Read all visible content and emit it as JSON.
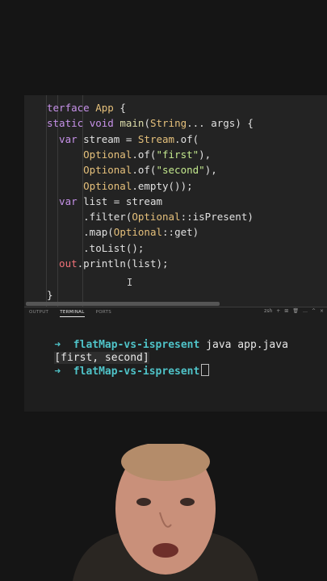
{
  "editor": {
    "lines": [
      {
        "parts": [
          {
            "t": "terface ",
            "c": "kw"
          },
          {
            "t": "App",
            "c": "cls"
          },
          {
            "t": " {",
            "c": "plain"
          }
        ]
      },
      {
        "parts": [
          {
            "t": "static ",
            "c": "kw"
          },
          {
            "t": "void ",
            "c": "kw"
          },
          {
            "t": "main",
            "c": "fn"
          },
          {
            "t": "(",
            "c": "plain"
          },
          {
            "t": "String",
            "c": "cls"
          },
          {
            "t": "... args) {",
            "c": "plain"
          }
        ]
      },
      {
        "parts": [
          {
            "t": "  var ",
            "c": "kw"
          },
          {
            "t": "stream",
            "c": "plain"
          },
          {
            "t": " = ",
            "c": "plain"
          },
          {
            "t": "Stream",
            "c": "cls"
          },
          {
            "t": ".of(",
            "c": "plain"
          }
        ]
      },
      {
        "parts": [
          {
            "t": "      Optional",
            "c": "cls"
          },
          {
            "t": ".of(",
            "c": "plain"
          },
          {
            "t": "\"first\"",
            "c": "str"
          },
          {
            "t": "),",
            "c": "plain"
          }
        ]
      },
      {
        "parts": [
          {
            "t": "      Optional",
            "c": "cls"
          },
          {
            "t": ".of(",
            "c": "plain"
          },
          {
            "t": "\"second\"",
            "c": "str"
          },
          {
            "t": "),",
            "c": "plain"
          }
        ]
      },
      {
        "parts": [
          {
            "t": "      Optional",
            "c": "cls"
          },
          {
            "t": ".empty());",
            "c": "plain"
          }
        ]
      },
      {
        "parts": [
          {
            "t": "  var ",
            "c": "kw"
          },
          {
            "t": "list = stream",
            "c": "plain"
          }
        ]
      },
      {
        "parts": [
          {
            "t": "      .filter(",
            "c": "plain"
          },
          {
            "t": "Optional",
            "c": "cls"
          },
          {
            "t": "::isPresent)",
            "c": "plain"
          }
        ]
      },
      {
        "parts": [
          {
            "t": "      .map(",
            "c": "plain"
          },
          {
            "t": "Optional",
            "c": "cls"
          },
          {
            "t": "::get)",
            "c": "plain"
          }
        ]
      },
      {
        "parts": [
          {
            "t": "      .toList();",
            "c": "plain"
          }
        ]
      },
      {
        "parts": [
          {
            "t": "  out",
            "c": "var"
          },
          {
            "t": ".println(list);",
            "c": "plain"
          }
        ]
      },
      {
        "parts": [
          {
            "t": "",
            "c": "plain"
          }
        ]
      },
      {
        "parts": [
          {
            "t": "}",
            "c": "plain"
          }
        ]
      }
    ]
  },
  "panel": {
    "tabs": [
      "OUTPUT",
      "TERMINAL",
      "PORTS"
    ],
    "active_tab": "TERMINAL",
    "tools": [
      "zsh",
      "+",
      "⊞",
      "🗑",
      "…",
      "^",
      "×"
    ]
  },
  "terminal": {
    "prompt_arrow": "➜",
    "dir": "flatMap-vs-ispresent",
    "command": " java app.java",
    "output": "[first, second]"
  }
}
